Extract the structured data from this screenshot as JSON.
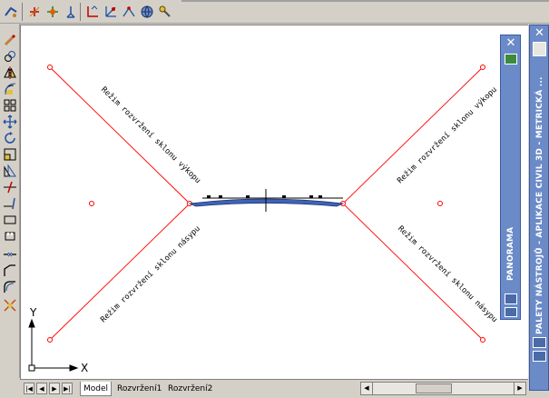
{
  "tabs": [
    {
      "label": "Model",
      "active": true
    },
    {
      "label": "Rozvržení1",
      "active": false
    },
    {
      "label": "Rozvržení2",
      "active": false
    }
  ],
  "drawing": {
    "label_cut_top": "Režim rozvržení sklonu výkopu",
    "label_fill_bottom": "Režim rozvržení sklonu násypu",
    "ucs_y": "Y",
    "ucs_x": "X"
  },
  "panorama_palette": {
    "title": "PANORAMA"
  },
  "tool_palette": {
    "title": "PALETY NÁSTROJŮ - APLIKACE CIVIL 3D - METRICKÁ ..."
  },
  "colors": {
    "palette_blue": "#6b8bc8",
    "crosshair_red": "#ff0000",
    "road_blue": "#3f63b5"
  }
}
